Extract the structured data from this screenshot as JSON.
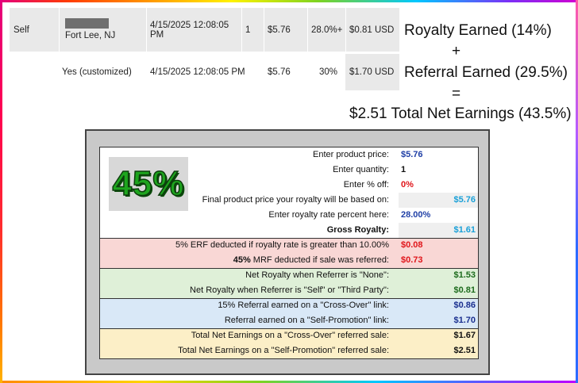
{
  "sales_table": {
    "row1": {
      "col1": "Self",
      "location": "Fort Lee, NJ",
      "date_line1": "4/15/2025 12:08:05",
      "date_line2": "PM",
      "quantity": "1",
      "price": "$5.76",
      "rate": "28.0%+",
      "earned": "$0.81 USD"
    },
    "row2": {
      "col2": "Yes (customized)",
      "date": "4/15/2025 12:08:05 PM",
      "price": "$5.76",
      "rate": "30%",
      "earned": "$1.70 USD"
    }
  },
  "formula": {
    "line1": "Royalty Earned (14%)",
    "plus": "+",
    "line2": "Referral Earned (29.5%)",
    "equals": "=",
    "line3": "$2.51 Total Net Earnings (43.5%)"
  },
  "calculator": {
    "badge": "45%",
    "rows": [
      {
        "label": "Enter product price:",
        "value": "$5.76"
      },
      {
        "label": "Enter quantity:",
        "value": "1"
      },
      {
        "label": "Enter % off:",
        "value": "0%"
      },
      {
        "label": "Final product price your royalty will be based on:",
        "value": "$5.76"
      },
      {
        "label": "Enter royalty rate percent here:",
        "value": "28.00%"
      },
      {
        "label": "Gross Royalty:",
        "value": "$1.61"
      },
      {
        "label": "5% ERF deducted if royalty rate is greater than 10.00%",
        "value": "$0.08"
      },
      {
        "label_prefix": "45%",
        "label": " MRF deducted if sale was referred:",
        "value": "$0.73"
      },
      {
        "label": "Net Royalty when Referrer is \"None\":",
        "value": "$1.53"
      },
      {
        "label": "Net Royalty when Referrer is \"Self\" or \"Third Party\":",
        "value": "$0.81"
      },
      {
        "label": "15% Referral earned on a \"Cross-Over\" link:",
        "value": "$0.86"
      },
      {
        "label": "Referral earned on a \"Self-Promotion\" link:",
        "value": "$1.70"
      },
      {
        "label": "Total Net Earnings on a \"Cross-Over\" referred sale:",
        "value": "$1.67"
      },
      {
        "label": "Total Net Earnings on a \"Self-Promotion\" referred sale:",
        "value": "$2.51"
      }
    ]
  },
  "colors": {
    "red_band": "#f9d7d5",
    "green_band": "#dff0d8",
    "blue_band": "#d9e8f7",
    "yellow_band": "#fcefc7",
    "badge_green": "#1ea51e"
  }
}
